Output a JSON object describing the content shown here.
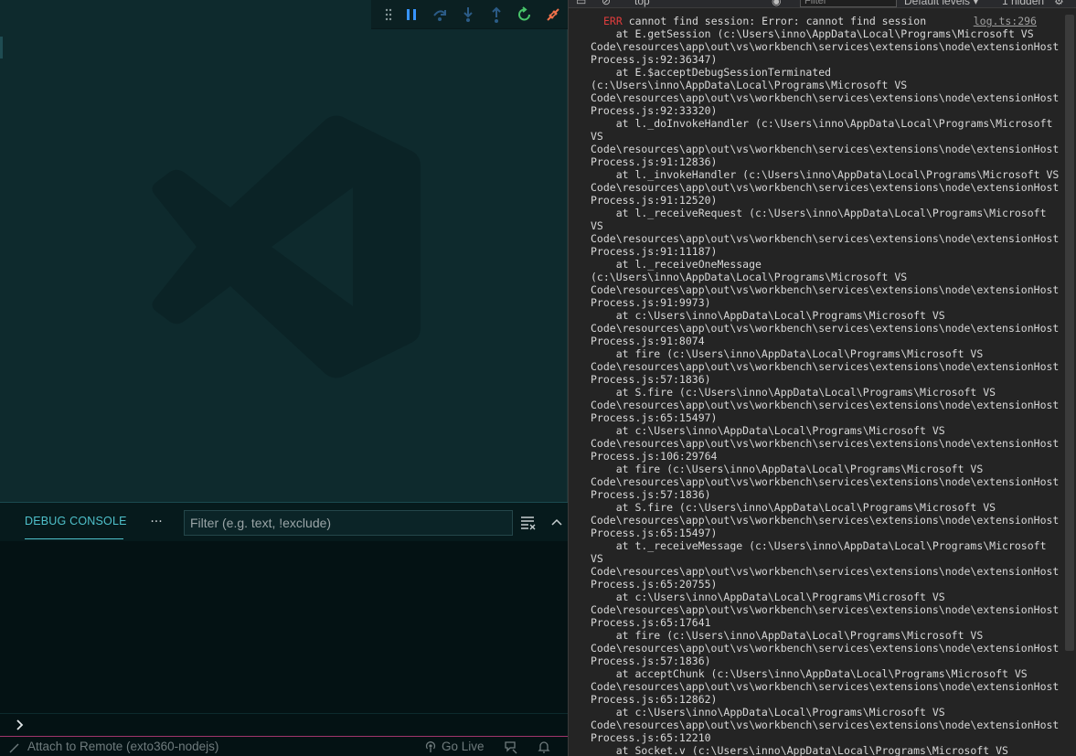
{
  "debug_toolbar": {
    "buttons": [
      "grip-icon",
      "pause-icon",
      "step-over-icon",
      "step-into-icon",
      "step-out-icon",
      "restart-icon",
      "disconnect-icon"
    ]
  },
  "panel": {
    "tab_label": "DEBUG CONSOLE",
    "more_label": "···",
    "filter_placeholder": "Filter (e.g. text, !exclude)"
  },
  "statusbar": {
    "remote_label": "Attach to Remote (exto360-nodejs)",
    "golive_label": "Go Live"
  },
  "devtools": {
    "context_label": "top",
    "filter_placeholder": "Filter",
    "levels_label": "Default levels ▾",
    "hidden_label": "1 hidden",
    "log": {
      "level": "ERR",
      "message": "cannot find session: Error: cannot find session",
      "source": "log.ts:296",
      "stack": "    at E.getSession (c:\\Users\\inno\\AppData\\Local\\Programs\\Microsoft VS\nCode\\resources\\app\\out\\vs\\workbench\\services\\extensions\\node\\extensionHost\nProcess.js:92:36347)\n    at E.$acceptDebugSessionTerminated\n(c:\\Users\\inno\\AppData\\Local\\Programs\\Microsoft VS\nCode\\resources\\app\\out\\vs\\workbench\\services\\extensions\\node\\extensionHost\nProcess.js:92:33320)\n    at l._doInvokeHandler (c:\\Users\\inno\\AppData\\Local\\Programs\\Microsoft\nVS\nCode\\resources\\app\\out\\vs\\workbench\\services\\extensions\\node\\extensionHost\nProcess.js:91:12836)\n    at l._invokeHandler (c:\\Users\\inno\\AppData\\Local\\Programs\\Microsoft VS\nCode\\resources\\app\\out\\vs\\workbench\\services\\extensions\\node\\extensionHost\nProcess.js:91:12520)\n    at l._receiveRequest (c:\\Users\\inno\\AppData\\Local\\Programs\\Microsoft\nVS\nCode\\resources\\app\\out\\vs\\workbench\\services\\extensions\\node\\extensionHost\nProcess.js:91:11187)\n    at l._receiveOneMessage\n(c:\\Users\\inno\\AppData\\Local\\Programs\\Microsoft VS\nCode\\resources\\app\\out\\vs\\workbench\\services\\extensions\\node\\extensionHost\nProcess.js:91:9973)\n    at c:\\Users\\inno\\AppData\\Local\\Programs\\Microsoft VS\nCode\\resources\\app\\out\\vs\\workbench\\services\\extensions\\node\\extensionHost\nProcess.js:91:8074\n    at fire (c:\\Users\\inno\\AppData\\Local\\Programs\\Microsoft VS\nCode\\resources\\app\\out\\vs\\workbench\\services\\extensions\\node\\extensionHost\nProcess.js:57:1836)\n    at S.fire (c:\\Users\\inno\\AppData\\Local\\Programs\\Microsoft VS\nCode\\resources\\app\\out\\vs\\workbench\\services\\extensions\\node\\extensionHost\nProcess.js:65:15497)\n    at c:\\Users\\inno\\AppData\\Local\\Programs\\Microsoft VS\nCode\\resources\\app\\out\\vs\\workbench\\services\\extensions\\node\\extensionHost\nProcess.js:106:29764\n    at fire (c:\\Users\\inno\\AppData\\Local\\Programs\\Microsoft VS\nCode\\resources\\app\\out\\vs\\workbench\\services\\extensions\\node\\extensionHost\nProcess.js:57:1836)\n    at S.fire (c:\\Users\\inno\\AppData\\Local\\Programs\\Microsoft VS\nCode\\resources\\app\\out\\vs\\workbench\\services\\extensions\\node\\extensionHost\nProcess.js:65:15497)\n    at t._receiveMessage (c:\\Users\\inno\\AppData\\Local\\Programs\\Microsoft\nVS\nCode\\resources\\app\\out\\vs\\workbench\\services\\extensions\\node\\extensionHost\nProcess.js:65:20755)\n    at c:\\Users\\inno\\AppData\\Local\\Programs\\Microsoft VS\nCode\\resources\\app\\out\\vs\\workbench\\services\\extensions\\node\\extensionHost\nProcess.js:65:17641\n    at fire (c:\\Users\\inno\\AppData\\Local\\Programs\\Microsoft VS\nCode\\resources\\app\\out\\vs\\workbench\\services\\extensions\\node\\extensionHost\nProcess.js:57:1836)\n    at acceptChunk (c:\\Users\\inno\\AppData\\Local\\Programs\\Microsoft VS\nCode\\resources\\app\\out\\vs\\workbench\\services\\extensions\\node\\extensionHost\nProcess.js:65:12862)\n    at c:\\Users\\inno\\AppData\\Local\\Programs\\Microsoft VS\nCode\\resources\\app\\out\\vs\\workbench\\services\\extensions\\node\\extensionHost\nProcess.js:65:12210\n    at Socket.v (c:\\Users\\inno\\AppData\\Local\\Programs\\Microsoft VS"
    }
  },
  "colors": {
    "editor_bg": "#0e2a2d",
    "accent_cyan": "#4fc1cb",
    "error_red": "#e03d3d",
    "pause_blue": "#3794ff",
    "restart_green": "#48c46a",
    "disconnect_orange": "#f0714b",
    "statusbar_border": "#a0356b"
  }
}
